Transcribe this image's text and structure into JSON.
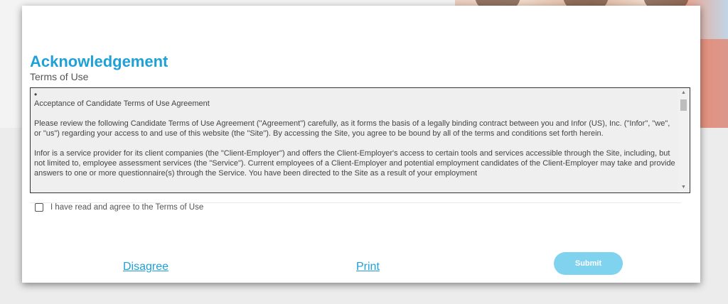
{
  "modal": {
    "title": "Acknowledgement",
    "subtitle": "Terms of Use",
    "terms": {
      "bullet": "•",
      "heading": "Acceptance of Candidate Terms of Use Agreement",
      "paragraphs": [
        "Please review the following Candidate Terms of Use Agreement (\"Agreement\") carefully, as it forms the basis of a legally binding contract between you and Infor (US), Inc. (\"Infor\", \"we\", or \"us\") regarding your access to and use of this website (the \"Site\"). By accessing the Site, you agree to be bound by all of the terms and conditions set forth herein.",
        "Infor is a service provider for its client companies (the \"Client-Employer\") and offers the Client-Employer's access to certain tools and services accessible through the Site, including, but not limited to, employee assessment services (the \"Service\"). Current employees of a Client-Employer and potential employment candidates of the Client-Employer may take and provide answers to one or more questionnaire(s) through the Service. You have been directed to the Site as a result of your employment"
      ]
    },
    "agree_checkbox": {
      "label": "I have read and agree to the Terms of Use",
      "checked": false
    },
    "actions": {
      "disagree": "Disagree",
      "print": "Print",
      "submit": "Submit"
    }
  },
  "colors": {
    "accent": "#1fa0d6",
    "submit_disabled": "#7fd3ee"
  }
}
